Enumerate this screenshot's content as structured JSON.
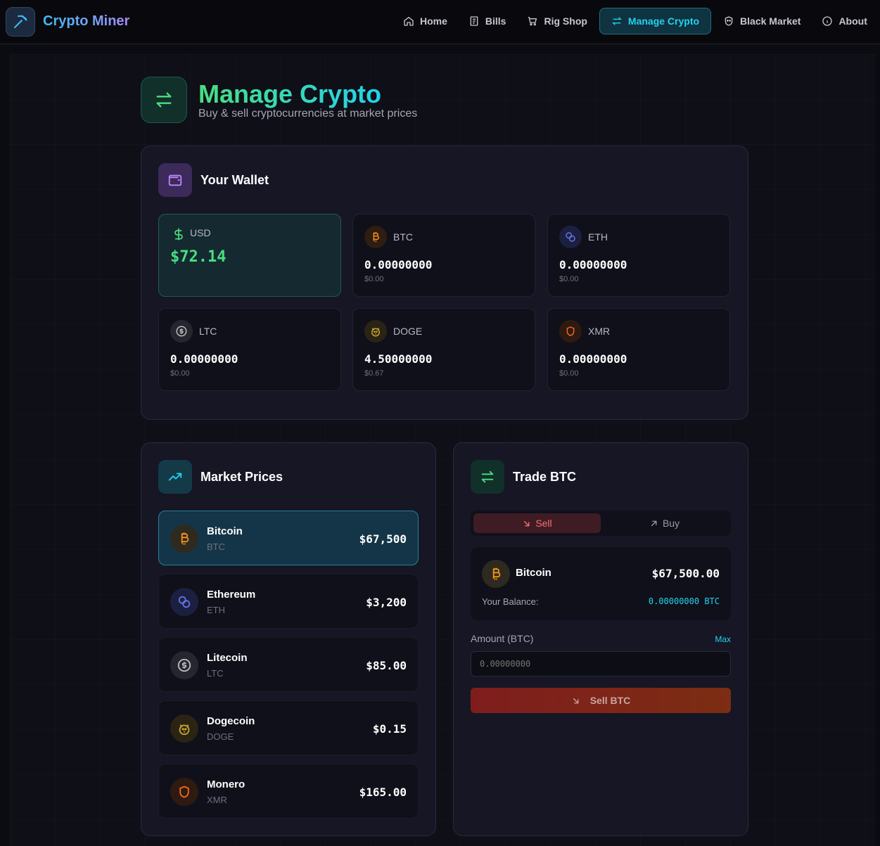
{
  "app": {
    "name": "Crypto Miner"
  },
  "nav": {
    "items": [
      {
        "label": "Home",
        "icon": "home-icon"
      },
      {
        "label": "Bills",
        "icon": "receipt-icon"
      },
      {
        "label": "Rig Shop",
        "icon": "cart-icon"
      },
      {
        "label": "Manage Crypto",
        "icon": "swap-icon",
        "active": true
      },
      {
        "label": "Black Market",
        "icon": "mask-icon"
      },
      {
        "label": "About",
        "icon": "info-icon"
      }
    ]
  },
  "page": {
    "title": "Manage Crypto",
    "subtitle": "Buy & sell cryptocurrencies at market prices"
  },
  "wallet": {
    "title": "Your Wallet",
    "usd": {
      "label": "USD",
      "amount": "$72.14"
    },
    "tiles": [
      {
        "symbol": "BTC",
        "amount": "0.00000000",
        "usd": "$0.00",
        "color": "#f7931a"
      },
      {
        "symbol": "ETH",
        "amount": "0.00000000",
        "usd": "$0.00",
        "color": "#6272e8"
      },
      {
        "symbol": "LTC",
        "amount": "0.00000000",
        "usd": "$0.00",
        "color": "#bdbdbd"
      },
      {
        "symbol": "DOGE",
        "amount": "4.50000000",
        "usd": "$0.67",
        "color": "#c8a633"
      },
      {
        "symbol": "XMR",
        "amount": "0.00000000",
        "usd": "$0.00",
        "color": "#f26822"
      }
    ]
  },
  "market": {
    "title": "Market Prices",
    "rows": [
      {
        "name": "Bitcoin",
        "symbol": "BTC",
        "price": "$67,500",
        "selected": true
      },
      {
        "name": "Ethereum",
        "symbol": "ETH",
        "price": "$3,200"
      },
      {
        "name": "Litecoin",
        "symbol": "LTC",
        "price": "$85.00"
      },
      {
        "name": "Dogecoin",
        "symbol": "DOGE",
        "price": "$0.15"
      },
      {
        "name": "Monero",
        "symbol": "XMR",
        "price": "$165.00"
      }
    ]
  },
  "trade": {
    "title": "Trade BTC",
    "sell_label": "Sell",
    "buy_label": "Buy",
    "asset_name": "Bitcoin",
    "asset_price": "$67,500.00",
    "balance_label": "Your Balance:",
    "balance_value": "0.00000000 BTC",
    "amount_label": "Amount (BTC)",
    "max_label": "Max",
    "amount_placeholder": "0.00000000",
    "action_label": "Sell BTC"
  },
  "colors": {
    "accent_cyan": "#22d3ee",
    "accent_green": "#4ade80",
    "sell_red": "#f87171"
  }
}
